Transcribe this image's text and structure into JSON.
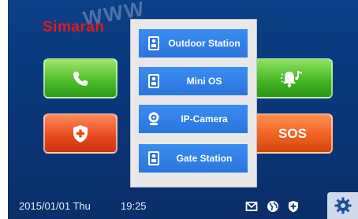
{
  "brand": "Simaran",
  "watermark": "WWW",
  "tiles": {
    "sos_label": "SOS"
  },
  "menu": {
    "items": [
      {
        "label": "Outdoor Station",
        "icon": "intercom-panel-icon"
      },
      {
        "label": "Mini OS",
        "icon": "intercom-panel-icon"
      },
      {
        "label": "IP-Camera",
        "icon": "camera-icon"
      },
      {
        "label": "Gate Station",
        "icon": "intercom-panel-icon"
      }
    ]
  },
  "status": {
    "date": "2015/01/01 Thu",
    "time": "19:25"
  },
  "colors": {
    "accent_blue": "#2a74de",
    "background": "#0b3f86",
    "brand_red": "#e31a1a",
    "green_tile": "#4fbf2b",
    "orange_tile": "#ea4c20"
  }
}
